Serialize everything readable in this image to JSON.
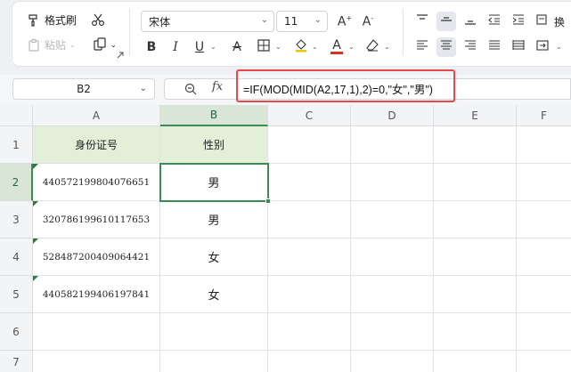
{
  "ribbon": {
    "format_painter_label": "格式刷",
    "paste_label": "粘贴",
    "font_name": "宋体",
    "font_size": "11",
    "wrap_label": "换"
  },
  "formula_bar": {
    "cell_ref": "B2",
    "fx_label": "fx",
    "formula": "=IF(MOD(MID(A2,17,1),2)=0,\"女\",\"男\")"
  },
  "columns": [
    "A",
    "B",
    "C",
    "D",
    "E",
    "F"
  ],
  "rows": [
    "1",
    "2",
    "3",
    "4",
    "5",
    "6",
    "7"
  ],
  "table": {
    "headers": [
      "身份证号",
      "性别"
    ],
    "rows": [
      [
        "440572199804076651",
        "男"
      ],
      [
        "320786199610117653",
        "男"
      ],
      [
        "528487200409064421",
        "女"
      ],
      [
        "440582199406197841",
        "女"
      ]
    ]
  },
  "colors": {
    "accent": "#3c8b55",
    "header_fill": "#e3efd9",
    "highlight": "#e44a4a"
  }
}
